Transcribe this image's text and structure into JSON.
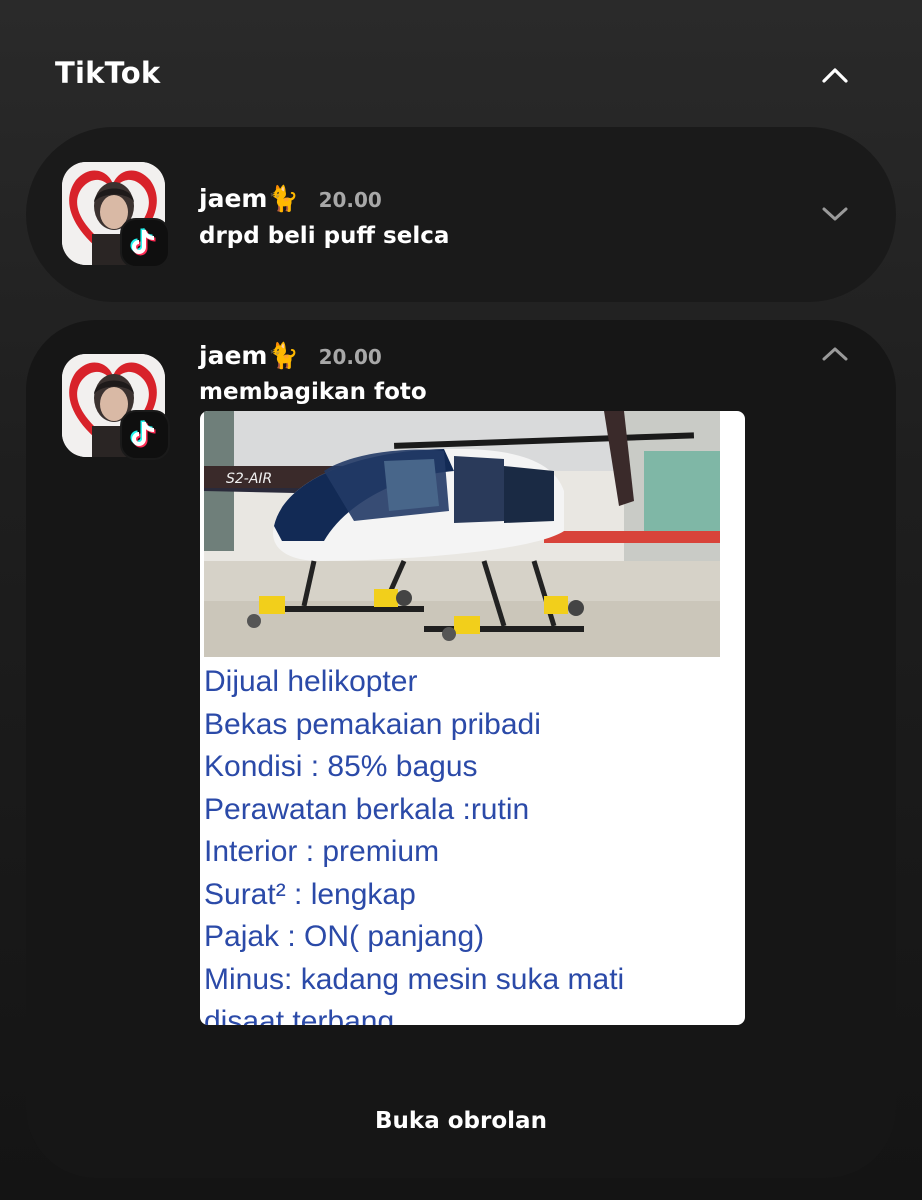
{
  "app": {
    "title": "TikTok"
  },
  "notifications": [
    {
      "sender": "jaem🐈",
      "time": "20.00",
      "message": "drpd beli puff selca",
      "expanded": false
    },
    {
      "sender": "jaem🐈",
      "time": "20.00",
      "message": "membagikan foto",
      "expanded": true,
      "photo_text": [
        "Dijual helikopter",
        "Bekas pemakaian pribadi",
        "Kondisi : 85% bagus",
        "Perawatan berkala :rutin",
        "Interior : premium",
        "Surat² : lengkap",
        "Pajak : ON( panjang)",
        "Minus: kadang mesin suka mati",
        "disaat terbang."
      ],
      "photo_label": "S2-AIR",
      "action_label": "Buka obrolan"
    }
  ],
  "colors": {
    "photo_text": "#2b4aa8",
    "accent_cyan": "#25f4ee",
    "accent_red": "#fe2c55"
  },
  "icons": {
    "app_collapse": "chevron-up-icon",
    "tiktok_badge": "tiktok-logo-icon"
  }
}
